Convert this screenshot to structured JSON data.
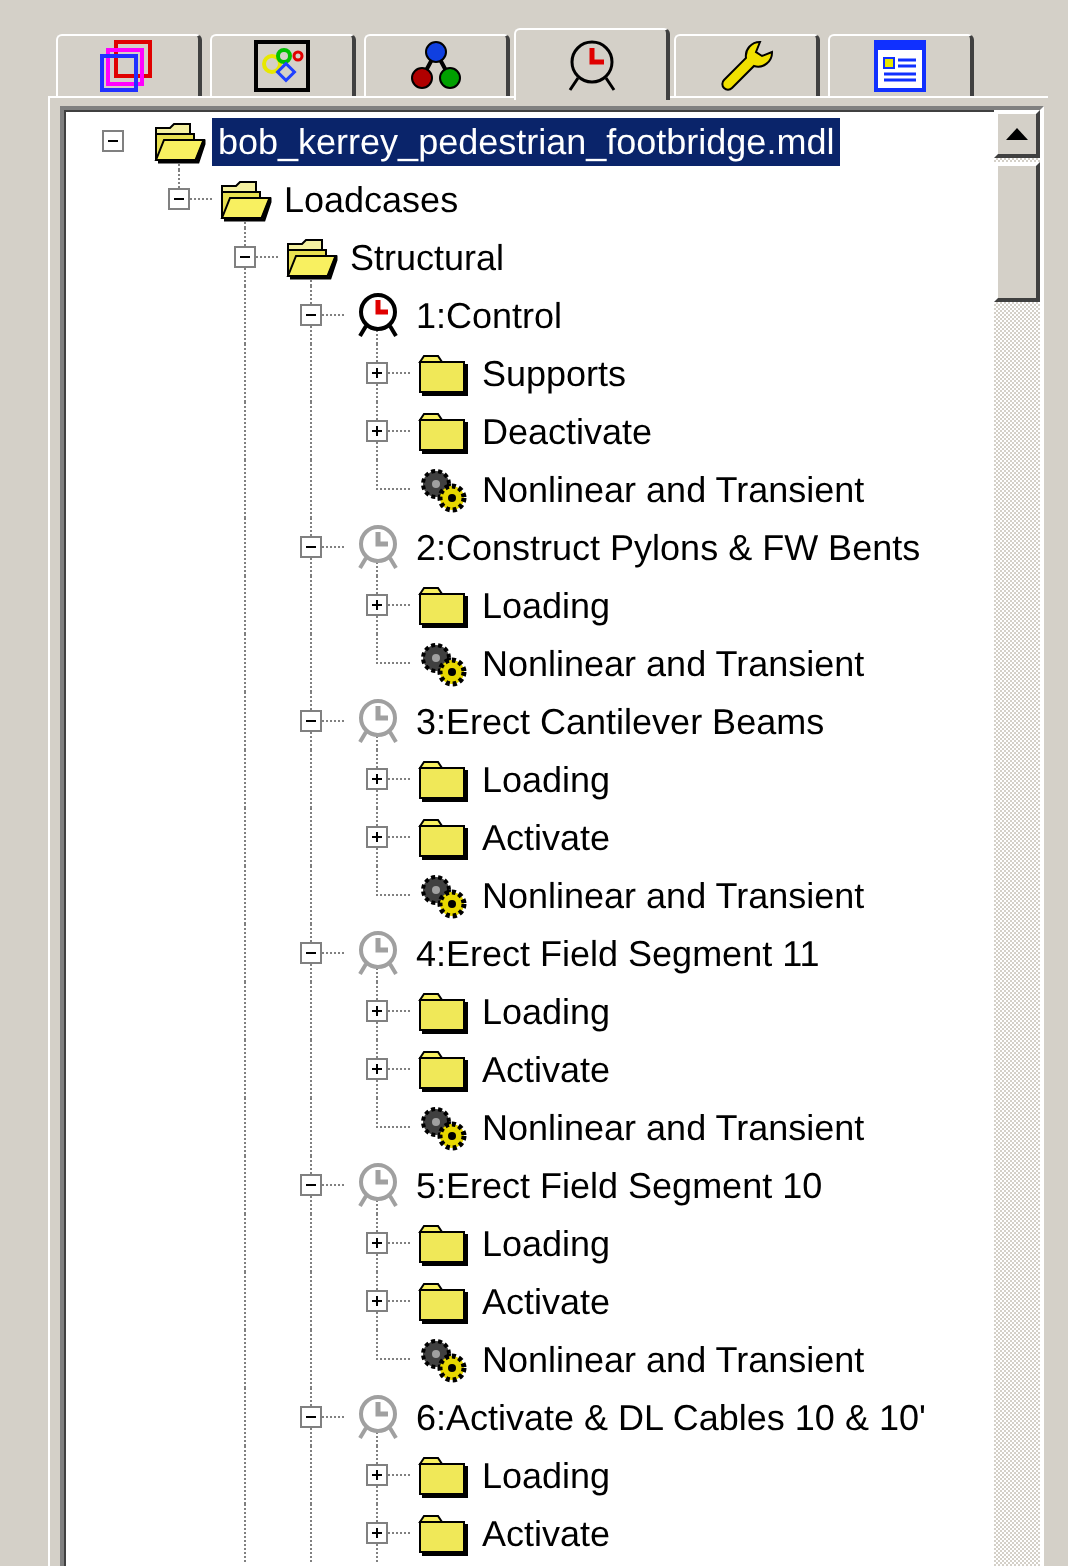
{
  "tabs": [
    {
      "selected": false
    },
    {
      "selected": false
    },
    {
      "selected": false
    },
    {
      "selected": true
    },
    {
      "selected": false
    },
    {
      "selected": false
    }
  ],
  "tree": [
    {
      "label": "bob_kerrey_pedestrian_footbridge.mdl",
      "kind": "folder",
      "expanded": true,
      "selected": true,
      "children": [
        {
          "label": "Loadcases",
          "kind": "folder",
          "expanded": true,
          "selected": false,
          "children": [
            {
              "label": "Structural",
              "kind": "folder",
              "expanded": true,
              "selected": false,
              "more_below": true,
              "children": [
                {
                  "label": "1:Control",
                  "kind": "loadcase",
                  "active": true,
                  "expanded": true,
                  "selected": false,
                  "children": [
                    {
                      "label": "Supports",
                      "kind": "folder",
                      "expanded": false,
                      "selected": false
                    },
                    {
                      "label": "Deactivate",
                      "kind": "folder",
                      "expanded": false,
                      "selected": false
                    },
                    {
                      "label": "Nonlinear and Transient",
                      "kind": "solver",
                      "selected": false
                    }
                  ]
                },
                {
                  "label": "2:Construct Pylons & FW Bents",
                  "kind": "loadcase",
                  "active": false,
                  "expanded": true,
                  "selected": false,
                  "children": [
                    {
                      "label": "Loading",
                      "kind": "folder",
                      "expanded": false,
                      "selected": false
                    },
                    {
                      "label": "Nonlinear and Transient",
                      "kind": "solver",
                      "selected": false
                    }
                  ]
                },
                {
                  "label": "3:Erect Cantilever Beams",
                  "kind": "loadcase",
                  "active": false,
                  "expanded": true,
                  "selected": false,
                  "children": [
                    {
                      "label": "Loading",
                      "kind": "folder",
                      "expanded": false,
                      "selected": false
                    },
                    {
                      "label": "Activate",
                      "kind": "folder",
                      "expanded": false,
                      "selected": false
                    },
                    {
                      "label": "Nonlinear and Transient",
                      "kind": "solver",
                      "selected": false
                    }
                  ]
                },
                {
                  "label": "4:Erect Field Segment 11",
                  "kind": "loadcase",
                  "active": false,
                  "expanded": true,
                  "selected": false,
                  "children": [
                    {
                      "label": "Loading",
                      "kind": "folder",
                      "expanded": false,
                      "selected": false
                    },
                    {
                      "label": "Activate",
                      "kind": "folder",
                      "expanded": false,
                      "selected": false
                    },
                    {
                      "label": "Nonlinear and Transient",
                      "kind": "solver",
                      "selected": false
                    }
                  ]
                },
                {
                  "label": "5:Erect Field Segment 10",
                  "kind": "loadcase",
                  "active": false,
                  "expanded": true,
                  "selected": false,
                  "children": [
                    {
                      "label": "Loading",
                      "kind": "folder",
                      "expanded": false,
                      "selected": false
                    },
                    {
                      "label": "Activate",
                      "kind": "folder",
                      "expanded": false,
                      "selected": false
                    },
                    {
                      "label": "Nonlinear and Transient",
                      "kind": "solver",
                      "selected": false
                    }
                  ]
                },
                {
                  "label": "6:Activate & DL Cables 10 & 10'",
                  "kind": "loadcase",
                  "active": false,
                  "expanded": true,
                  "selected": false,
                  "more_below": true,
                  "children": [
                    {
                      "label": "Loading",
                      "kind": "folder",
                      "expanded": false,
                      "selected": false
                    },
                    {
                      "label": "Activate",
                      "kind": "folder",
                      "expanded": false,
                      "selected": false,
                      "more_below": true
                    }
                  ]
                }
              ]
            }
          ]
        }
      ]
    }
  ]
}
